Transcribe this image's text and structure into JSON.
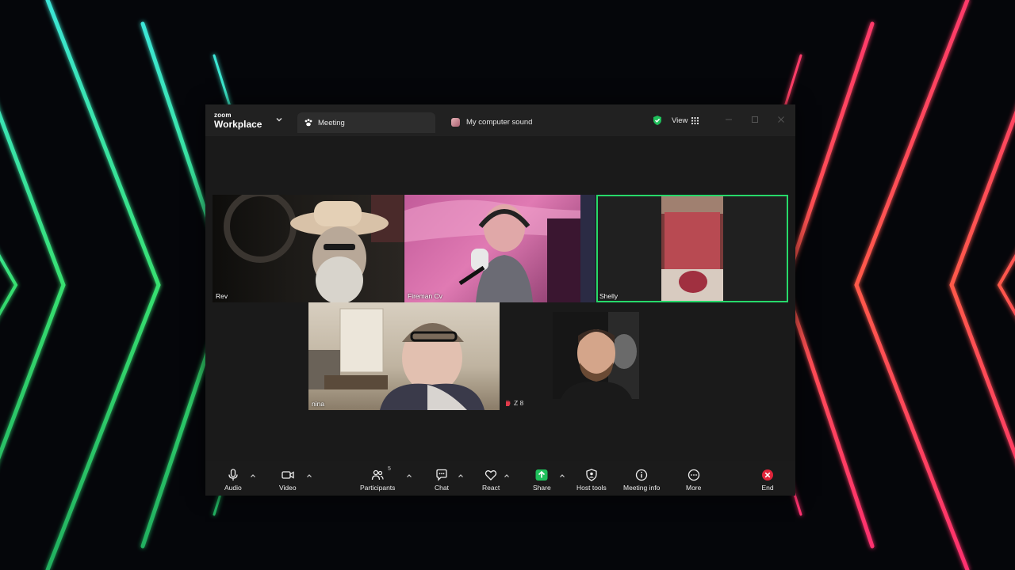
{
  "app": {
    "logo_small": "zoom",
    "logo_big": "Workplace",
    "tabs": [
      {
        "label": "Meeting"
      },
      {
        "label": "My computer sound"
      }
    ],
    "view_label": "View"
  },
  "participants": [
    {
      "name": "Rev"
    },
    {
      "name": "Fireman Cv"
    },
    {
      "name": "Shelly",
      "active": true
    },
    {
      "name": "nina"
    },
    {
      "name": ""
    }
  ],
  "reaction_badge": "Z 8",
  "toolbar": {
    "audio": "Audio",
    "video": "Video",
    "participants": "Participants",
    "participants_count": "5",
    "chat": "Chat",
    "react": "React",
    "share": "Share",
    "host_tools": "Host tools",
    "meeting_info": "Meeting info",
    "more": "More",
    "end": "End"
  },
  "colors": {
    "accent_green": "#27d96a",
    "share_green": "#1fbf5b",
    "end_red": "#e0243a",
    "window_bg": "#1a1a1a"
  }
}
